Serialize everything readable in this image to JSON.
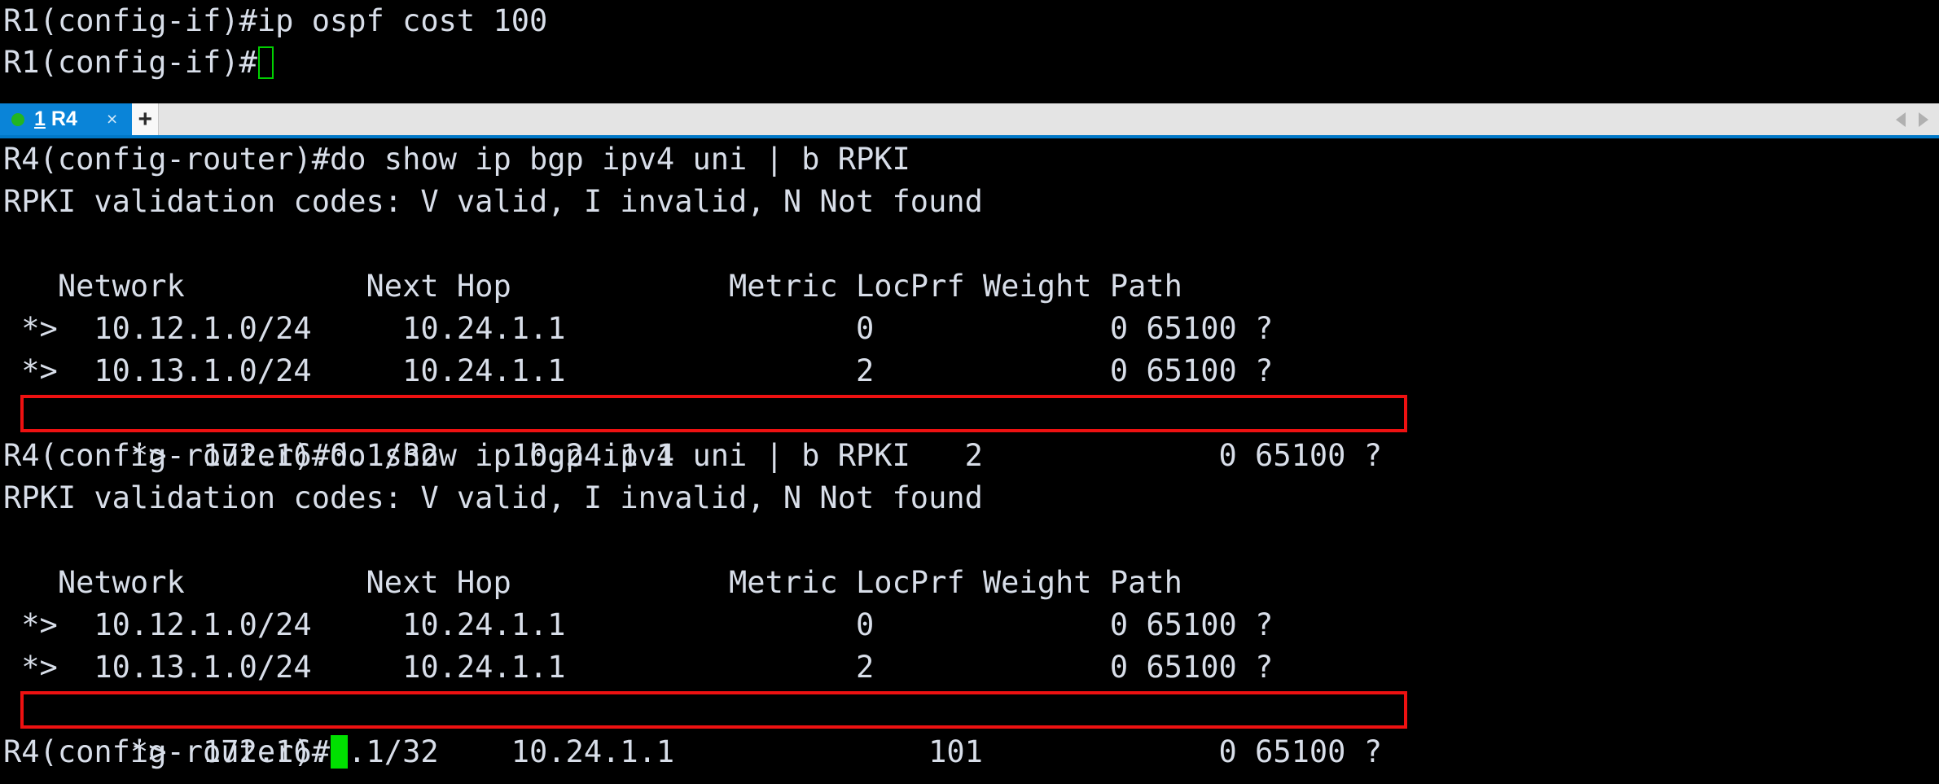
{
  "app": {
    "type": "terminal-emulator",
    "colors": {
      "background": "#000000",
      "foreground": "#d8dee9",
      "tab_active": "#0a84d8",
      "tabbar_background": "#e4e4e4",
      "tabbar_accent": "#0078c8",
      "cursor": "#00e000",
      "highlight_box": "#ee1111"
    }
  },
  "top_pane": {
    "name": "r1-console-output",
    "lines": [
      "R1(config-if)#ip ospf cost 100",
      "R1(config-if)#"
    ],
    "cursor_style": "hollow-block"
  },
  "tabbar": {
    "tabs": [
      {
        "index": "1",
        "title": "R4",
        "status": "connected",
        "status_dot_color": "#22b522",
        "close_label": "×",
        "active": true
      }
    ],
    "new_tab_label": "+",
    "scroll_left_label": "◀",
    "scroll_right_label": "▶"
  },
  "main_pane": {
    "name": "r4-console-output",
    "cursor_style": "filled-block",
    "prompt": "R4(config-router)#",
    "command": "do show ip bgp ipv4 uni | b RPKI",
    "rpki_legend": "RPKI validation codes: V valid, I invalid, N Not found",
    "table_header": "   Network          Next Hop            Metric LocPrf Weight Path",
    "outputs": [
      {
        "command_line": "R4(config-router)#do show ip bgp ipv4 uni | b RPKI",
        "legend_line": "RPKI validation codes: V valid, I invalid, N Not found",
        "blank_line": "",
        "header_line": "   Network          Next Hop            Metric LocPrf Weight Path",
        "rows": [
          {
            "status": " *>",
            "network": "10.12.1.0/24",
            "next_hop": "10.24.1.1",
            "metric": "0",
            "locprf": "",
            "weight": "0",
            "path": "65100 ?",
            "text": " *>  10.12.1.0/24     10.24.1.1                0             0 65100 ?",
            "highlighted": false
          },
          {
            "status": " *>",
            "network": "10.13.1.0/24",
            "next_hop": "10.24.1.1",
            "metric": "2",
            "locprf": "",
            "weight": "0",
            "path": "65100 ?",
            "text": " *>  10.13.1.0/24     10.24.1.1                2             0 65100 ?",
            "highlighted": false
          },
          {
            "status": " *>",
            "network": "172.16.0.1/32",
            "next_hop": "10.24.1.1",
            "metric": "2",
            "locprf": "",
            "weight": "0",
            "path": "65100 ?",
            "text": " *>  172.16.0.1/32    10.24.1.1                2             0 65100 ?",
            "highlighted": true
          }
        ]
      },
      {
        "command_line": "R4(config-router)#do show ip bgp ipv4 uni | b RPKI",
        "legend_line": "RPKI validation codes: V valid, I invalid, N Not found",
        "blank_line": "",
        "header_line": "   Network          Next Hop            Metric LocPrf Weight Path",
        "rows": [
          {
            "status": " *>",
            "network": "10.12.1.0/24",
            "next_hop": "10.24.1.1",
            "metric": "0",
            "locprf": "",
            "weight": "0",
            "path": "65100 ?",
            "text": " *>  10.12.1.0/24     10.24.1.1                0             0 65100 ?",
            "highlighted": false
          },
          {
            "status": " *>",
            "network": "10.13.1.0/24",
            "next_hop": "10.24.1.1",
            "metric": "2",
            "locprf": "",
            "weight": "0",
            "path": "65100 ?",
            "text": " *>  10.13.1.0/24     10.24.1.1                2             0 65100 ?",
            "highlighted": false
          },
          {
            "status": " *>",
            "network": "172.16.0.1/32",
            "next_hop": "10.24.1.1",
            "metric": "101",
            "locprf": "",
            "weight": "0",
            "path": "65100 ?",
            "text": " *>  172.16.0.1/32    10.24.1.1              101             0 65100 ?",
            "highlighted": true
          }
        ]
      }
    ],
    "final_prompt": "R4(config-router)#"
  }
}
